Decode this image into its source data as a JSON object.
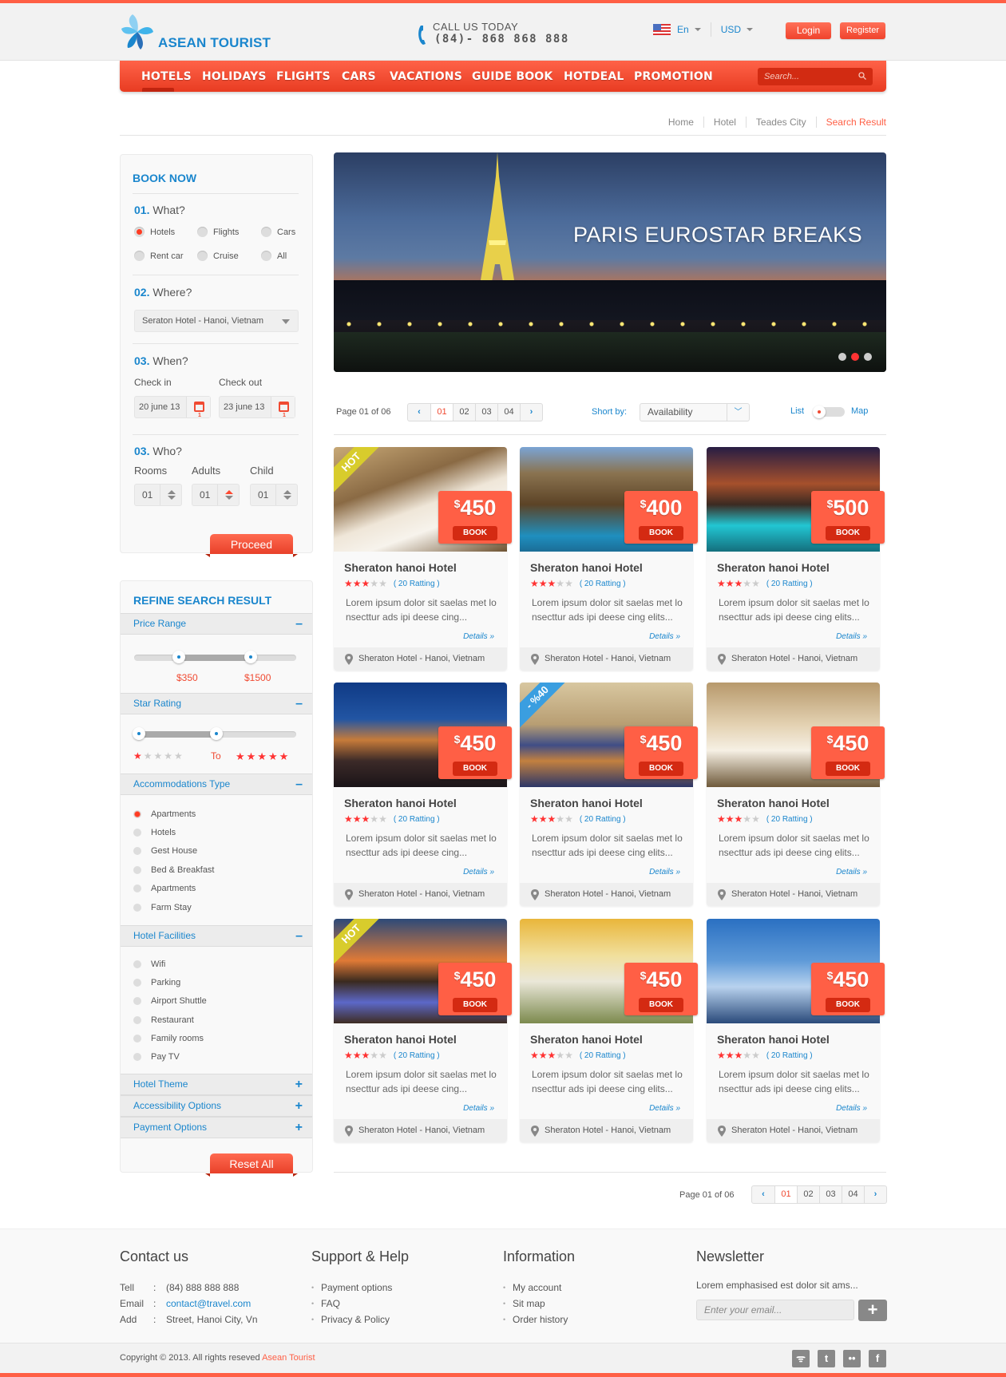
{
  "brand": {
    "name": "ASEAN TOURIST",
    "accent": "#ff5f45",
    "primary": "#1a86cd"
  },
  "header": {
    "call_label": "CALL US TODAY",
    "call_number": "(84)- 868 868 888",
    "language": "En",
    "currency": "USD",
    "login": "Login",
    "register": "Register"
  },
  "nav": {
    "items": [
      "HOTELS",
      "HOLIDAYS",
      "FLIGHTS",
      "CARS",
      "VACATIONS",
      "GUIDE BOOK",
      "HOTDEAL",
      "PROMOTION"
    ],
    "active": "HOTELS",
    "search_placeholder": "Search..."
  },
  "breadcrumb": [
    "Home",
    "Hotel",
    "Teades City",
    "Search Result"
  ],
  "book": {
    "title": "BOOK NOW",
    "what": {
      "num": "01.",
      "label": "What?",
      "options": [
        "Hotels",
        "Flights",
        "Cars",
        "Rent car",
        "Cruise",
        "All"
      ],
      "selected": "Hotels"
    },
    "where": {
      "num": "02.",
      "label": "Where?",
      "value": "Seraton Hotel - Hanoi, Vietnam"
    },
    "when": {
      "num": "03.",
      "label": "When?",
      "checkin_label": "Check in",
      "checkout_label": "Check out",
      "checkin": "20 june 13",
      "checkout": "23 june 13",
      "cal_glyph": "1"
    },
    "who": {
      "num": "03.",
      "label": "Who?",
      "rooms_label": "Rooms",
      "adults_label": "Adults",
      "child_label": "Child",
      "rooms": "01",
      "adults": "01",
      "child": "01"
    },
    "proceed": "Proceed"
  },
  "refine": {
    "title": "REFINE SEARCH RESULT",
    "price": {
      "label": "Price Range",
      "min": "$350",
      "max": "$1500",
      "toggle": "–"
    },
    "star": {
      "label": "Star Rating",
      "to": "To",
      "from_stars": 1,
      "to_stars": 5,
      "toggle": "–"
    },
    "accommodation": {
      "label": "Accommodations Type",
      "toggle": "–",
      "options": [
        "Apartments",
        "Hotels",
        "Gest House",
        "Bed & Breakfast",
        "Apartments",
        "Farm Stay"
      ],
      "selected_index": 0
    },
    "facilities": {
      "label": "Hotel Facilities",
      "toggle": "–",
      "options": [
        "Wifi",
        "Parking",
        "Airport Shuttle",
        "Restaurant",
        "Family rooms",
        "Pay TV"
      ]
    },
    "collapsed": [
      {
        "label": "Hotel Theme",
        "toggle": "+"
      },
      {
        "label": "Accessibility Options",
        "toggle": "+"
      },
      {
        "label": "Payment Options",
        "toggle": "+"
      }
    ],
    "reset": "Reset All"
  },
  "banner": {
    "title": "PARIS EUROSTAR BREAKS",
    "slides": 3,
    "active_slide": 2
  },
  "toolbar": {
    "page_label": "Page 01 of 06",
    "pages": [
      "01",
      "02",
      "03",
      "04"
    ],
    "current_page": "01",
    "prev": "‹",
    "next": "›",
    "sort_label": "Short by:",
    "sort_value": "Availability",
    "view_list": "List",
    "view_map": "Map"
  },
  "hotels": [
    {
      "name": "Sheraton hanoi Hotel",
      "price": "450",
      "currency": "$",
      "book": "BOOK",
      "stars": 3,
      "rating": "( 20 Ratting )",
      "desc": "Lorem ipsum dolor sit saelas met lo nsecttur ads ipi deese cing...",
      "details": "Details",
      "location": "Sheraton Hotel - Hanoi, Vietnam",
      "badge": "HOT",
      "badge_color": "#d8cc2c",
      "scene": "room1"
    },
    {
      "name": "Sheraton hanoi Hotel",
      "price": "400",
      "currency": "$",
      "book": "BOOK",
      "stars": 3,
      "rating": "( 20 Ratting )",
      "desc": "Lorem ipsum dolor sit saelas met lo nsecttur ads ipi deese cing elits...",
      "details": "Details",
      "location": "Sheraton Hotel - Hanoi, Vietnam",
      "badge": "",
      "scene": "hut"
    },
    {
      "name": "Sheraton hanoi Hotel",
      "price": "500",
      "currency": "$",
      "book": "BOOK",
      "stars": 3,
      "rating": "( 20 Ratting )",
      "desc": "Lorem ipsum dolor sit saelas met lo nsecttur ads ipi deese cing elits...",
      "details": "Details",
      "location": "Sheraton Hotel - Hanoi, Vietnam",
      "badge": "",
      "scene": "pool"
    },
    {
      "name": "Sheraton hanoi Hotel",
      "price": "450",
      "currency": "$",
      "book": "BOOK",
      "stars": 3,
      "rating": "( 20 Ratting )",
      "desc": "Lorem ipsum dolor sit saelas met lo nsecttur ads ipi deese cing...",
      "details": "Details",
      "location": "Sheraton Hotel - Hanoi, Vietnam",
      "badge": "",
      "scene": "building"
    },
    {
      "name": "Sheraton hanoi Hotel",
      "price": "450",
      "currency": "$",
      "book": "BOOK",
      "stars": 3,
      "rating": "( 20 Ratting )",
      "desc": "Lorem ipsum dolor sit saelas met lo nsecttur ads ipi deese cing elits...",
      "details": "Details",
      "location": "Sheraton Hotel - Hanoi, Vietnam",
      "badge": "- %40",
      "badge_color": "#3a9ee0",
      "scene": "room2"
    },
    {
      "name": "Sheraton hanoi Hotel",
      "price": "450",
      "currency": "$",
      "book": "BOOK",
      "stars": 3,
      "rating": "( 20 Ratting )",
      "desc": "Lorem ipsum dolor sit saelas met lo nsecttur ads ipi deese cing elits...",
      "details": "Details",
      "location": "Sheraton Hotel - Hanoi, Vietnam",
      "badge": "",
      "scene": "room3"
    },
    {
      "name": "Sheraton hanoi Hotel",
      "price": "450",
      "currency": "$",
      "book": "BOOK",
      "stars": 3,
      "rating": "( 20 Ratting )",
      "desc": "Lorem ipsum dolor sit saelas met lo nsecttur ads ipi deese cing...",
      "details": "Details",
      "location": "Sheraton Hotel - Hanoi, Vietnam",
      "badge": "HOT",
      "badge_color": "#d8cc2c",
      "scene": "sunset"
    },
    {
      "name": "Sheraton hanoi Hotel",
      "price": "450",
      "currency": "$",
      "book": "BOOK",
      "stars": 3,
      "rating": "( 20 Ratting )",
      "desc": "Lorem ipsum dolor sit saelas met lo nsecttur ads ipi deese cing elits...",
      "details": "Details",
      "location": "Sheraton Hotel - Hanoi, Vietnam",
      "badge": "",
      "scene": "room4"
    },
    {
      "name": "Sheraton hanoi Hotel",
      "price": "450",
      "currency": "$",
      "book": "BOOK",
      "stars": 3,
      "rating": "( 20 Ratting )",
      "desc": "Lorem ipsum dolor sit saelas met lo nsecttur ads ipi deese cing elits...",
      "details": "Details",
      "location": "Sheraton Hotel - Hanoi, Vietnam",
      "badge": "",
      "scene": "tower"
    }
  ],
  "footer": {
    "contact": {
      "title": "Contact us",
      "rows": [
        {
          "k": "Tell",
          "v": "(84) 888 888 888"
        },
        {
          "k": "Email",
          "v": "contact@travel.com"
        },
        {
          "k": "Add",
          "v": "Street, Hanoi City, Vn"
        }
      ]
    },
    "support": {
      "title": "Support & Help",
      "links": [
        "Payment options",
        "FAQ",
        "Privacy & Policy"
      ]
    },
    "info": {
      "title": "Information",
      "links": [
        "My account",
        "Sit map",
        "Order history"
      ]
    },
    "newsletter": {
      "title": "Newsletter",
      "desc": "Lorem emphasised est dolor sit ams...",
      "placeholder": "Enter your email...",
      "button": "+"
    },
    "copyright": "Copyright © 2013. All rights reseved ",
    "copyright_brand": "Asean Tourist",
    "social": [
      "rss",
      "twitter",
      "flickr",
      "facebook"
    ]
  }
}
